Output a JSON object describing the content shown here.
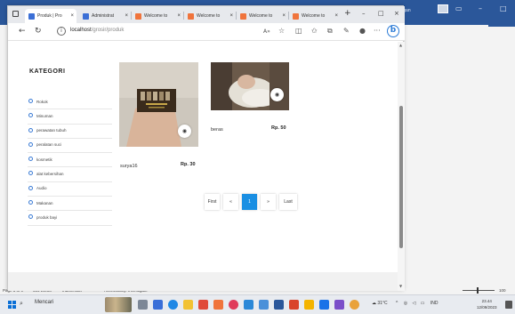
{
  "word": {
    "title_user": "Ira Nova Tengan",
    "status": {
      "page": "Page 5 of 9",
      "words": "654 words",
      "language": "Indonesian",
      "accessibility": "Accessibility: Investigate",
      "zoom": "100"
    }
  },
  "browser": {
    "tabs": [
      {
        "label": "Produk | Pro",
        "icon": "page-icon",
        "active": true
      },
      {
        "label": "Administrat",
        "icon": "page-icon",
        "active": false
      },
      {
        "label": "Welcome to",
        "icon": "xampp-icon",
        "active": false
      },
      {
        "label": "Welcome to",
        "icon": "xampp-icon",
        "active": false
      },
      {
        "label": "Welcome to",
        "icon": "xampp-icon",
        "active": false
      },
      {
        "label": "Welcome to",
        "icon": "xampp-icon",
        "active": false
      }
    ],
    "new_tab": "+",
    "url_host": "localhost",
    "url_path": "/grosir/produk",
    "colors": {
      "accent": "#1a8fe3",
      "xampp": "#f0743c"
    }
  },
  "page": {
    "sidebar_title": "KATEGORI",
    "categories": [
      "Rokok",
      "Minuman",
      "perawatan tubuh",
      "peralatan suci",
      "kosmetik",
      "alat kebersihan",
      "Audio",
      "Makanan",
      "produk bayi"
    ],
    "products": [
      {
        "name": "surya16",
        "price": "Rp. 30"
      },
      {
        "name": "beras",
        "price": "Rp. 50"
      }
    ],
    "pagination": {
      "first": "First",
      "prev": "«",
      "current": "1",
      "next": "»",
      "last": "Last"
    }
  },
  "taskbar": {
    "search_placeholder": "Mencari",
    "weather": "31°C",
    "language": "IND",
    "time": "23.44",
    "date": "12/09/2023"
  }
}
